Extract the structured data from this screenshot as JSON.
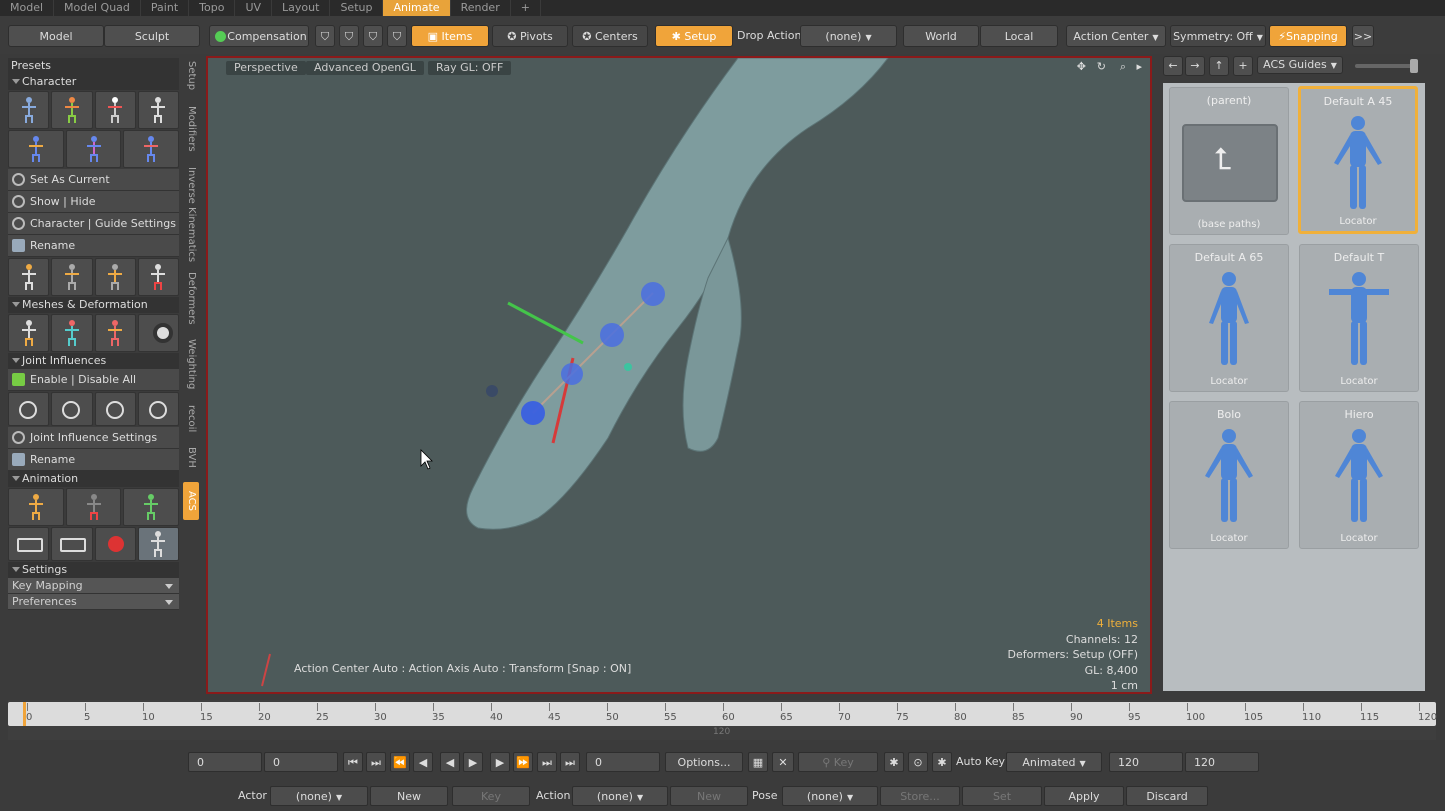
{
  "tabs": [
    "Model",
    "Model Quad",
    "Paint",
    "Topo",
    "UV",
    "Layout",
    "Setup",
    "Animate",
    "Render",
    "+"
  ],
  "toolbar": {
    "model": "Model",
    "sculpt": "Sculpt",
    "compensation": "Compensation",
    "items": "Items",
    "pivots": "Pivots",
    "centers": "Centers",
    "setup": "Setup",
    "drop_action": "Drop Action",
    "none": "(none)",
    "world": "World",
    "local": "Local",
    "action_center": "Action Center",
    "symmetry": "Symmetry: Off",
    "snapping": "Snapping",
    "more": ">>"
  },
  "left": {
    "presets": "Presets",
    "character": "Character",
    "set_current": "Set As Current",
    "show_hide": "Show | Hide",
    "char_guide": "Character | Guide Settings",
    "rename": "Rename",
    "meshes": "Meshes & Deformation",
    "joint_inf": "Joint Influences",
    "enable_disable": "Enable | Disable All",
    "joint_inf_settings": "Joint Influence Settings",
    "rename2": "Rename",
    "animation": "Animation",
    "settings": "Settings",
    "key_mapping": "Key Mapping",
    "preferences": "Preferences"
  },
  "vtabs": [
    "Setup",
    "Modifiers",
    "Inverse Kinematics",
    "Deformers",
    "Weighting",
    "recoil",
    "BVH",
    "ACS"
  ],
  "viewport": {
    "perspective": "Perspective",
    "opengl": "Advanced OpenGL",
    "raygl": "Ray GL: OFF",
    "status": "Action Center Auto : Action Axis Auto : Transform  [Snap : ON]",
    "info": [
      "4 Items",
      "Channels: 12",
      "Deformers: Setup (OFF)",
      "GL: 8,400",
      "1 cm"
    ]
  },
  "right": {
    "guides": "ACS Guides",
    "cards": [
      {
        "title": "(parent)",
        "bottom": "(base paths)"
      },
      {
        "title": "Default A 45",
        "bottom": "Locator"
      },
      {
        "title": "Default A 65",
        "bottom": "Locator"
      },
      {
        "title": "Default T",
        "bottom": "Locator"
      },
      {
        "title": "Bolo",
        "bottom": "Locator"
      },
      {
        "title": "Hiero",
        "bottom": "Locator"
      }
    ]
  },
  "timeline": {
    "ticks": [
      "0",
      "5",
      "10",
      "15",
      "20",
      "25",
      "30",
      "35",
      "40",
      "45",
      "50",
      "55",
      "60",
      "65",
      "70",
      "75",
      "80",
      "85",
      "90",
      "95",
      "100",
      "105",
      "110",
      "115",
      "120"
    ],
    "marker": "120"
  },
  "transport": {
    "f1": "0",
    "f2": "0",
    "cur": "0",
    "options": "Options...",
    "key": "Key",
    "autokey": "Auto Key",
    "animated": "Animated",
    "end1": "120",
    "end2": "120"
  },
  "bottom": {
    "actor": "Actor",
    "none": "(none)",
    "new": "New",
    "key": "Key",
    "action": "Action",
    "new2": "New",
    "pose": "Pose",
    "store": "Store...",
    "set": "Set",
    "apply": "Apply",
    "discard": "Discard"
  },
  "colors": {
    "accent": "#f0a43a",
    "viewport_border": "#8a1a1a",
    "figure_blue": "#4f86d6"
  }
}
